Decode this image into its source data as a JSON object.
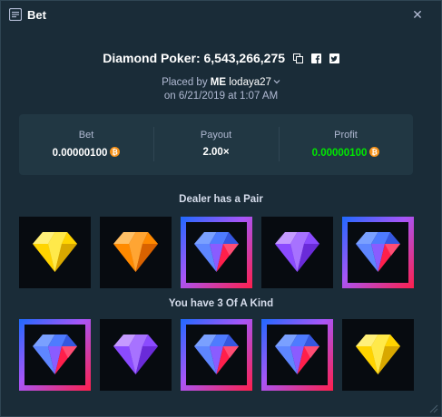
{
  "header": {
    "title": "Bet",
    "icons": [
      "bet-slip-icon",
      "close-icon"
    ]
  },
  "bet": {
    "game": "Diamond Poker",
    "bet_id": "6,543,266,275",
    "game_line": "Diamond Poker: 6,543,266,275",
    "share_icons": [
      "copy-icon",
      "facebook-icon",
      "twitter-icon"
    ],
    "placed_by_prefix": "Placed by",
    "placed_by_badge": "ME",
    "username": "lodaya27",
    "date_line": "on 6/21/2019 at 1:07 AM"
  },
  "stats": {
    "bet_label": "Bet",
    "bet_value": "0.00000100",
    "payout_label": "Payout",
    "payout_value": "2.00×",
    "profit_label": "Profit",
    "profit_value": "0.00000100",
    "currency_icon": "bitcoin-icon"
  },
  "dealer": {
    "label": "Dealer has a Pair",
    "cards": [
      {
        "gem": "yellow",
        "highlighted": false
      },
      {
        "gem": "orange",
        "highlighted": false
      },
      {
        "gem": "blue-red",
        "highlighted": true
      },
      {
        "gem": "purple",
        "highlighted": false
      },
      {
        "gem": "blue-red",
        "highlighted": true
      }
    ]
  },
  "player": {
    "label": "You have 3 Of A Kind",
    "cards": [
      {
        "gem": "blue-red",
        "highlighted": true
      },
      {
        "gem": "purple",
        "highlighted": false
      },
      {
        "gem": "blue-red",
        "highlighted": true
      },
      {
        "gem": "blue-red",
        "highlighted": true
      },
      {
        "gem": "yellow",
        "highlighted": false
      }
    ]
  },
  "colors": {
    "background": "#1a2c38",
    "panel": "#213743",
    "profit_green": "#00e701",
    "highlight_blue": "#1f6aff",
    "highlight_red": "#ff1f4b",
    "highlight_purple": "#a855f7",
    "coin_orange": "#f7931a"
  }
}
